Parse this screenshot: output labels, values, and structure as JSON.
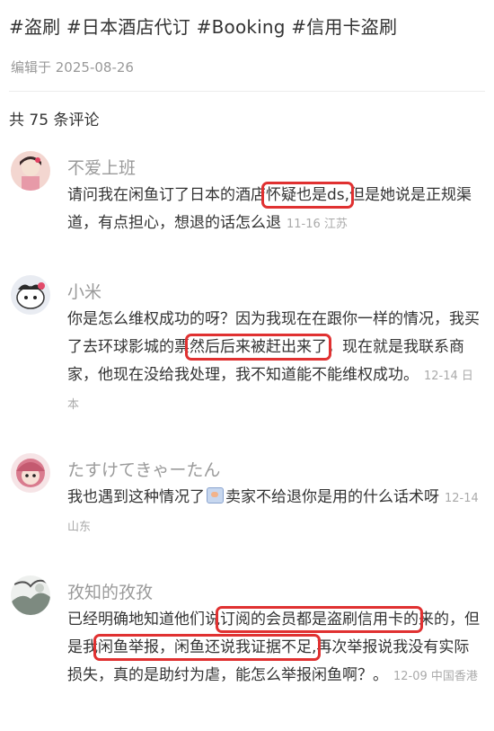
{
  "post": {
    "tags": "#盗刷 #日本酒店代订 #Booking #信用卡盗刷",
    "edited": "编辑于 2025-08-26"
  },
  "comments_header": {
    "count_text": "共 75 条评论"
  },
  "comments": [
    {
      "user": "不爱上班",
      "text_before": "请问我在闲鱼订了日本的酒店",
      "highlight": "怀疑也是ds,",
      "text_after": "但是她说是正规渠道，有点担心，想退的话怎么退",
      "date": "11-16",
      "location": "江苏"
    },
    {
      "user": "小米",
      "text_before": "你是怎么维权成功的呀？因为我现在在跟你一样的情况，我买了去环球影城的票",
      "highlight": "然后后来被赶出来了",
      "text_after": "，现在就是我联系商家，他现在没给我处理，我不知道能不能维权成功。",
      "date": "12-14",
      "location": "日本"
    },
    {
      "user": "たすけてきゃーたん",
      "text_before": "我也遇到这种情况了",
      "emoji": "emoji-icon",
      "text_after": "卖家不给退你是用的什么话术呀",
      "date": "12-14",
      "location": "山东"
    },
    {
      "user": "孜知的孜孜",
      "text_before": "已经明确地知道他们说",
      "highlight": "订阅的会员都是盗刷信用卡的",
      "text_mid": "来的，但是我",
      "highlight2": "闲鱼举报，闲鱼还说我证据不足,",
      "text_after": "再次举报说我没有实际损失，真的是助纣为虐，能怎么举报闲鱼啊？。",
      "date": "12-09",
      "location": "中国香港"
    }
  ],
  "colors": {
    "highlight_box": "#e03131",
    "muted": "#999999"
  }
}
